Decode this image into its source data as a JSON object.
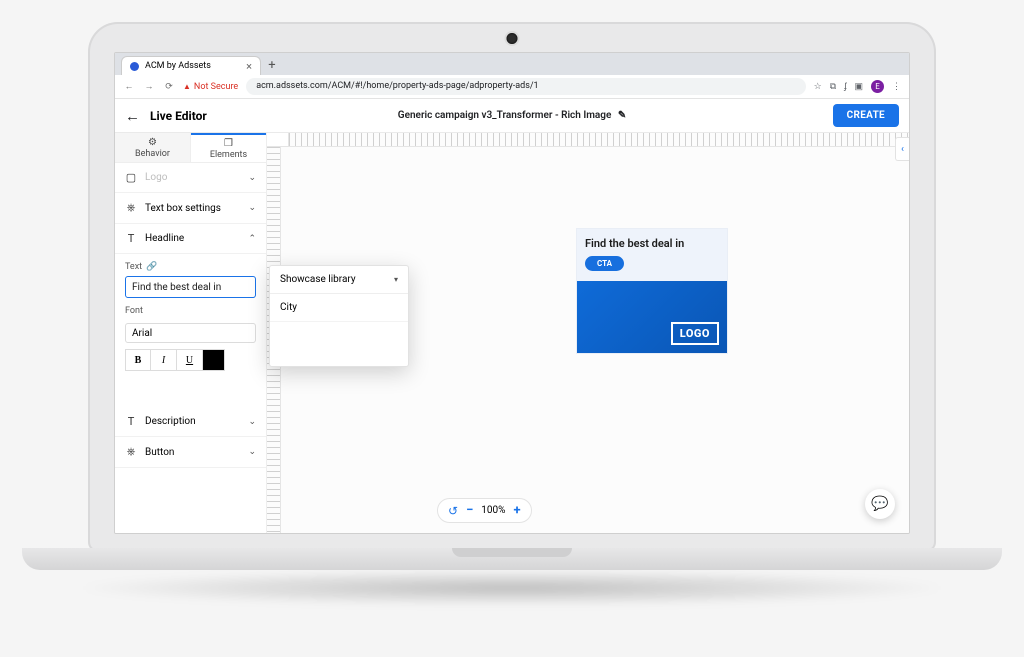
{
  "browser": {
    "tab_title": "ACM by Adssets",
    "not_secure": "Not Secure",
    "url": "acm.adssets.com/ACM/#!/home/property-ads-page/adproperty-ads/1"
  },
  "appbar": {
    "title": "Live Editor",
    "campaign": "Generic campaign v3_Transformer - Rich Image",
    "create": "CREATE"
  },
  "tabs": {
    "behavior": "Behavior",
    "elements": "Elements"
  },
  "rows": {
    "logo": "Logo",
    "textbox": "Text box settings",
    "headline": "Headline",
    "description": "Description",
    "button": "Button"
  },
  "headline": {
    "text_label": "Text",
    "text_value": "Find the best deal in",
    "font_label": "Font",
    "font_value": "Arial",
    "b": "B",
    "i": "I",
    "u": "U"
  },
  "popover": {
    "title": "Showcase library",
    "item1": "City"
  },
  "preview": {
    "headline": "Find the best deal in",
    "cta": "CTA",
    "logo": "LOGO"
  },
  "zoom": {
    "level": "100%"
  }
}
